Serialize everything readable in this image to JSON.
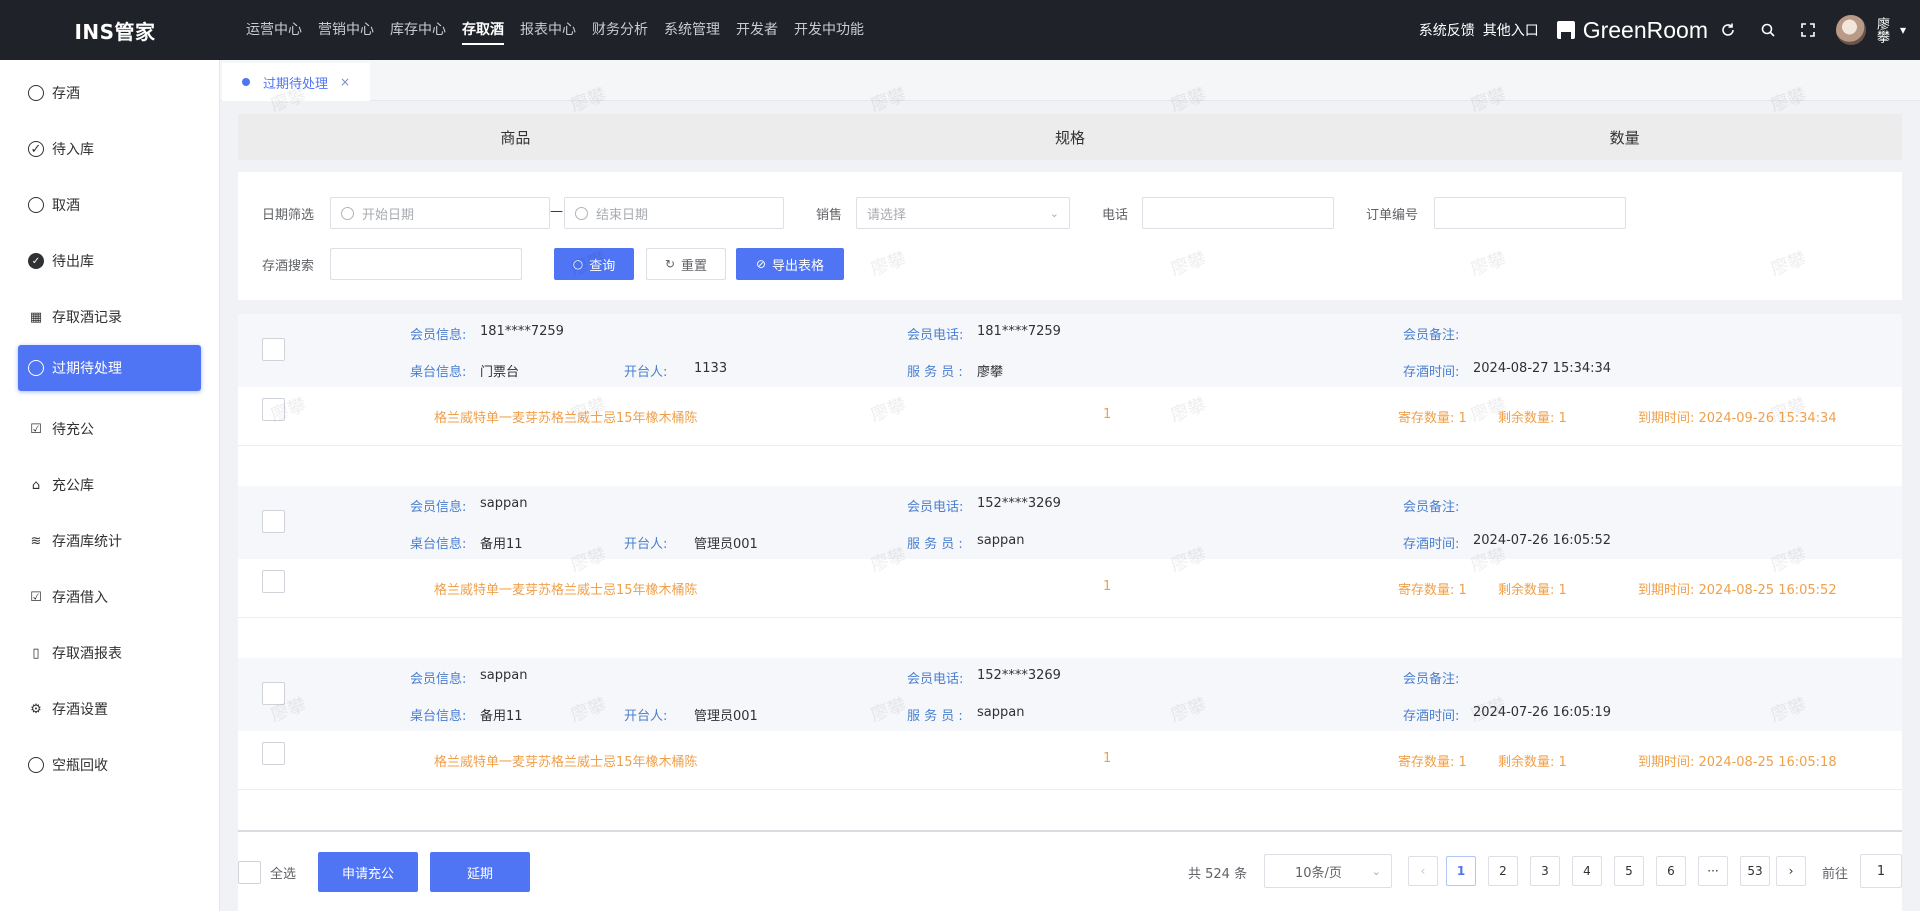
{
  "app": {
    "title": "INS管家"
  },
  "topnav": [
    "运营中心",
    "营销中心",
    "库存中心",
    "存取酒",
    "报表中心",
    "财务分析",
    "系统管理",
    "开发者",
    "开发中功能"
  ],
  "topright": {
    "feedback": "系统反馈",
    "other": "其他入口",
    "store": "GreenRoom",
    "user": "廖攀"
  },
  "sidebar": [
    "存酒",
    "待入库",
    "取酒",
    "待出库",
    "存取酒记录",
    "过期待处理",
    "待充公",
    "充公库",
    "存酒库统计",
    "存酒借入",
    "存取酒报表",
    "存酒设置",
    "空瓶回收"
  ],
  "tab": {
    "label": "过期待处理",
    "close": "×"
  },
  "watermark": "廖攀",
  "columns": [
    "商品",
    "规格",
    "数量"
  ],
  "filter": {
    "date_label": "日期筛选",
    "start_placeholder": "开始日期",
    "dash": "—",
    "end_placeholder": "结束日期",
    "sales_label": "销售",
    "sales_placeholder": "请选择",
    "phone_label": "电话",
    "order_label": "订单编号",
    "search_label": "存酒搜索",
    "query": "查询",
    "reset": "重置",
    "export": "导出表格"
  },
  "labels": {
    "member": "会员信息:",
    "member_phone": "会员电话:",
    "member_note": "会员备注:",
    "table": "桌台信息:",
    "opener": "开台人:",
    "waiter": "服 务 员 :",
    "store_time": "存酒时间:",
    "store_qty": "寄存数量: ",
    "remain_qty": "剩余数量: ",
    "expire": "到期时间: "
  },
  "orders": [
    {
      "member": "181****7259",
      "phone": "181****7259",
      "note": "",
      "table": "门票台",
      "opener": "1133",
      "waiter": "廖攀",
      "time": "2024-08-27 15:34:34",
      "product": "格兰威特单一麦芽苏格兰威士忌15年橡木桶陈",
      "spec": "1",
      "store_qty": "1",
      "remain_qty": "1",
      "expire": "2024-09-26 15:34:34"
    },
    {
      "member": "sappan",
      "phone": "152****3269",
      "note": "",
      "table": "备用11",
      "opener": "管理员001",
      "waiter": "sappan",
      "time": "2024-07-26 16:05:52",
      "product": "格兰威特单一麦芽苏格兰威士忌15年橡木桶陈",
      "spec": "1",
      "store_qty": "1",
      "remain_qty": "1",
      "expire": "2024-08-25 16:05:52"
    },
    {
      "member": "sappan",
      "phone": "152****3269",
      "note": "",
      "table": "备用11",
      "opener": "管理员001",
      "waiter": "sappan",
      "time": "2024-07-26 16:05:19",
      "product": "格兰威特单一麦芽苏格兰威士忌15年橡木桶陈",
      "spec": "1",
      "store_qty": "1",
      "remain_qty": "1",
      "expire": "2024-08-25 16:05:18"
    }
  ],
  "footer": {
    "select_all": "全选",
    "apply": "申请充公",
    "extend": "延期",
    "total": "共 524 条",
    "page_size": "10条/页",
    "pages": [
      "1",
      "2",
      "3",
      "4",
      "5",
      "6",
      "···",
      "53"
    ],
    "goto": "前往",
    "goto_value": "1"
  }
}
